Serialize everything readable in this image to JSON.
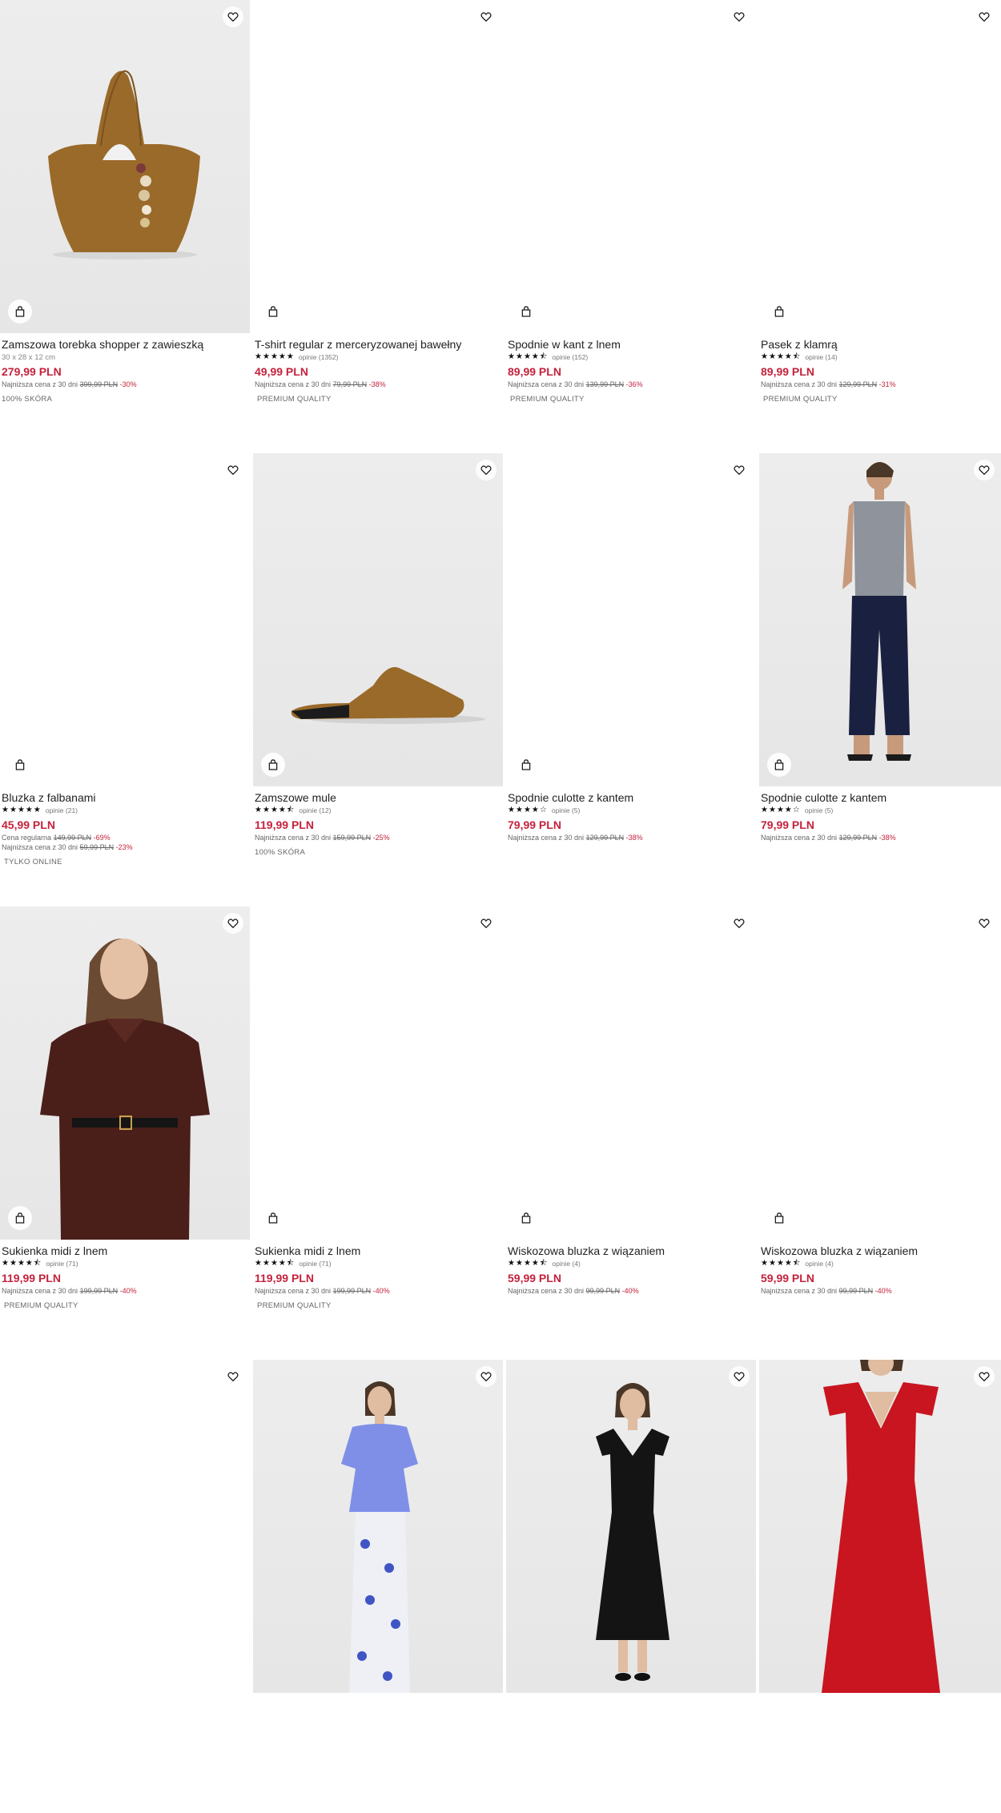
{
  "colors": {
    "price": "#c4223c",
    "text": "#222222",
    "muted": "#777777"
  },
  "products": [
    {
      "name": "Zamszowa torebka shopper z zawieszką",
      "sub": "30 x 28 x 12 cm",
      "rating": null,
      "reviews": "",
      "price": "279,99 PLN",
      "regular_label": "",
      "regular_price": "",
      "regular_pct": "",
      "lowest_label": "Najniższa cena z 30 dni",
      "lowest_price": "399,99 PLN",
      "lowest_pct": "-30%",
      "tag": "100% SKÓRA",
      "image": "bag"
    },
    {
      "name": "T-shirt regular z merceryzowanej bawełny",
      "sub": "",
      "rating": 5,
      "reviews": "opinie (1352)",
      "price": "49,99 PLN",
      "regular_label": "",
      "regular_price": "",
      "regular_pct": "",
      "lowest_label": "Najniższa cena z 30 dni",
      "lowest_price": "79,99 PLN",
      "lowest_pct": "-38%",
      "tag": "PREMIUM QUALITY",
      "image": "blank"
    },
    {
      "name": "Spodnie w kant z lnem",
      "sub": "",
      "rating": 4.5,
      "reviews": "opinie (152)",
      "price": "89,99 PLN",
      "regular_label": "",
      "regular_price": "",
      "regular_pct": "",
      "lowest_label": "Najniższa cena z 30 dni",
      "lowest_price": "139,99 PLN",
      "lowest_pct": "-36%",
      "tag": "PREMIUM QUALITY",
      "image": "blank"
    },
    {
      "name": "Pasek z klamrą",
      "sub": "",
      "rating": 4.5,
      "reviews": "opinie (14)",
      "price": "89,99 PLN",
      "regular_label": "",
      "regular_price": "",
      "regular_pct": "",
      "lowest_label": "Najniższa cena z 30 dni",
      "lowest_price": "129,99 PLN",
      "lowest_pct": "-31%",
      "tag": "PREMIUM QUALITY",
      "image": "blank"
    },
    {
      "name": "Bluzka z falbanami",
      "sub": "",
      "rating": 5,
      "reviews": "opinie (21)",
      "price": "45,99 PLN",
      "regular_label": "Cena regularna",
      "regular_price": "149,99 PLN",
      "regular_pct": "-69%",
      "lowest_label": "Najniższa cena z 30 dni",
      "lowest_price": "59,99 PLN",
      "lowest_pct": "-23%",
      "tag": "TYLKO ONLINE",
      "image": "blank"
    },
    {
      "name": "Zamszowe mule",
      "sub": "",
      "rating": 4.5,
      "reviews": "opinie (12)",
      "price": "119,99 PLN",
      "regular_label": "",
      "regular_price": "",
      "regular_pct": "",
      "lowest_label": "Najniższa cena z 30 dni",
      "lowest_price": "159,99 PLN",
      "lowest_pct": "-25%",
      "tag": "100% SKÓRA",
      "image": "mule"
    },
    {
      "name": "Spodnie culotte z kantem",
      "sub": "",
      "rating": 4,
      "reviews": "opinie (5)",
      "price": "79,99 PLN",
      "regular_label": "",
      "regular_price": "",
      "regular_pct": "",
      "lowest_label": "Najniższa cena z 30 dni",
      "lowest_price": "129,99 PLN",
      "lowest_pct": "-38%",
      "tag": "",
      "image": "blank"
    },
    {
      "name": "Spodnie culotte z kantem",
      "sub": "",
      "rating": 4,
      "reviews": "opinie (5)",
      "price": "79,99 PLN",
      "regular_label": "",
      "regular_price": "",
      "regular_pct": "",
      "lowest_label": "Najniższa cena z 30 dni",
      "lowest_price": "129,99 PLN",
      "lowest_pct": "-38%",
      "tag": "",
      "image": "culotte"
    },
    {
      "name": "Sukienka midi z lnem",
      "sub": "",
      "rating": 4.5,
      "reviews": "opinie (71)",
      "price": "119,99 PLN",
      "regular_label": "",
      "regular_price": "",
      "regular_pct": "",
      "lowest_label": "Najniższa cena z 30 dni",
      "lowest_price": "199,99 PLN",
      "lowest_pct": "-40%",
      "tag": "PREMIUM QUALITY",
      "image": "dress_brown"
    },
    {
      "name": "Sukienka midi z lnem",
      "sub": "",
      "rating": 4.5,
      "reviews": "opinie (71)",
      "price": "119,99 PLN",
      "regular_label": "",
      "regular_price": "",
      "regular_pct": "",
      "lowest_label": "Najniższa cena z 30 dni",
      "lowest_price": "199,99 PLN",
      "lowest_pct": "-40%",
      "tag": "PREMIUM QUALITY",
      "image": "blank"
    },
    {
      "name": "Wiskozowa bluzka z wiązaniem",
      "sub": "",
      "rating": 4.5,
      "reviews": "opinie (4)",
      "price": "59,99 PLN",
      "regular_label": "",
      "regular_price": "",
      "regular_pct": "",
      "lowest_label": "Najniższa cena z 30 dni",
      "lowest_price": "99,99 PLN",
      "lowest_pct": "-40%",
      "tag": "",
      "image": "blank"
    },
    {
      "name": "Wiskozowa bluzka z wiązaniem",
      "sub": "",
      "rating": 4.5,
      "reviews": "opinie (4)",
      "price": "59,99 PLN",
      "regular_label": "",
      "regular_price": "",
      "regular_pct": "",
      "lowest_label": "Najniższa cena z 30 dni",
      "lowest_price": "99,99 PLN",
      "lowest_pct": "-40%",
      "tag": "",
      "image": "blank"
    },
    {
      "name": "",
      "sub": "",
      "rating": null,
      "reviews": "",
      "price": "",
      "regular_label": "",
      "regular_price": "",
      "regular_pct": "",
      "lowest_label": "",
      "lowest_price": "",
      "lowest_pct": "",
      "tag": "",
      "image": "blank"
    },
    {
      "name": "",
      "sub": "",
      "rating": null,
      "reviews": "",
      "price": "",
      "regular_label": "",
      "regular_price": "",
      "regular_pct": "",
      "lowest_label": "",
      "lowest_price": "",
      "lowest_pct": "",
      "tag": "",
      "image": "blue_top"
    },
    {
      "name": "",
      "sub": "",
      "rating": null,
      "reviews": "",
      "price": "",
      "regular_label": "",
      "regular_price": "",
      "regular_pct": "",
      "lowest_label": "",
      "lowest_price": "",
      "lowest_pct": "",
      "tag": "",
      "image": "black_dress"
    },
    {
      "name": "",
      "sub": "",
      "rating": null,
      "reviews": "",
      "price": "",
      "regular_label": "",
      "regular_price": "",
      "regular_pct": "",
      "lowest_label": "",
      "lowest_price": "",
      "lowest_pct": "",
      "tag": "",
      "image": "red_dress"
    }
  ]
}
